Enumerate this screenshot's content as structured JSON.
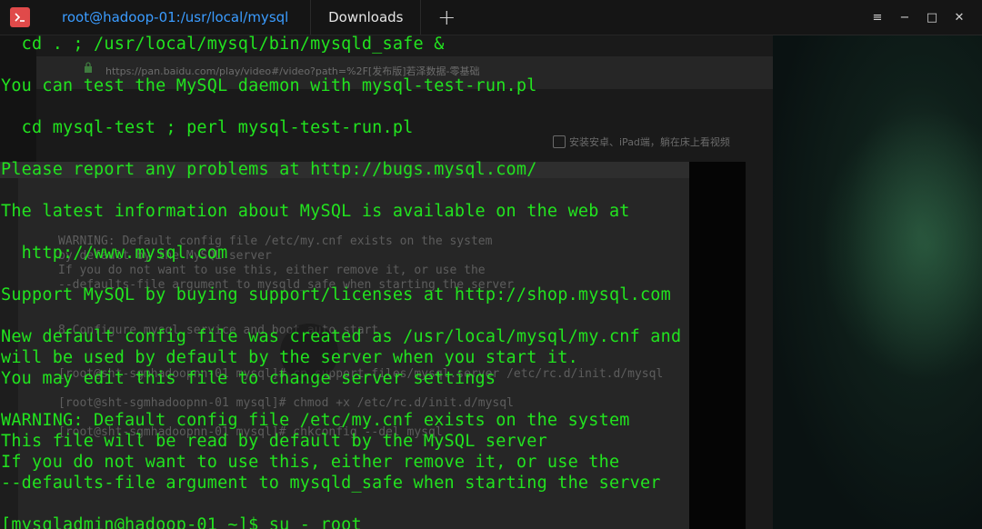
{
  "titlebar": {
    "tabs": [
      {
        "label": "root@hadoop-01:/usr/local/mysql",
        "active": true
      },
      {
        "label": "Downloads",
        "active": false
      }
    ],
    "add_tab_glyph": "+",
    "controls": {
      "menu": "≡",
      "minimize": "−",
      "maximize": "□",
      "close": "✕"
    }
  },
  "background": {
    "url": "https://pan.baidu.com/play/video#/video?path=%2F[发布版]若泽数据-零基础",
    "promo": "安装安卓、iPad端，躺在床上看视频",
    "screen_lines": [
      "WARNING: Default config file /etc/my.cnf exists on the system",
      "by default by the MySQL server",
      "If you do not want to use this, either remove it, or use the",
      "--defaults-file argument to mysqld_safe when starting the server",
      "8.Configure mysql service and boot auto start",
      "[root@sht-sgmhadoopnn-01 mysql]# cp support-files/mysql.server /etc/rc.d/init.d/mysql",
      "[root@sht-sgmhadoopnn-01 mysql]# chmod +x /etc/rc.d/init.d/mysql",
      "[root@sht-sgmhadoopnn-01 mysql]# chkconfig --del mysql"
    ]
  },
  "terminal": {
    "lines": [
      "  cd . ; /usr/local/mysql/bin/mysqld_safe &",
      "",
      "You can test the MySQL daemon with mysql-test-run.pl",
      "",
      "  cd mysql-test ; perl mysql-test-run.pl",
      "",
      "Please report any problems at http://bugs.mysql.com/",
      "",
      "The latest information about MySQL is available on the web at",
      "",
      "  http://www.mysql.com",
      "",
      "Support MySQL by buying support/licenses at http://shop.mysql.com",
      "",
      "New default config file was created as /usr/local/mysql/my.cnf and",
      "will be used by default by the server when you start it.",
      "You may edit this file to change server settings",
      "",
      "WARNING: Default config file /etc/my.cnf exists on the system",
      "This file will be read by default by the MySQL server",
      "If you do not want to use this, either remove it, or use the",
      "--defaults-file argument to mysqld_safe when starting the server",
      "",
      "[mysqladmin@hadoop-01 ~]$ su - root"
    ]
  },
  "colors": {
    "terminal_text": "#22e31f",
    "active_tab": "#3b9cff",
    "app_icon": "#e04a4a"
  }
}
